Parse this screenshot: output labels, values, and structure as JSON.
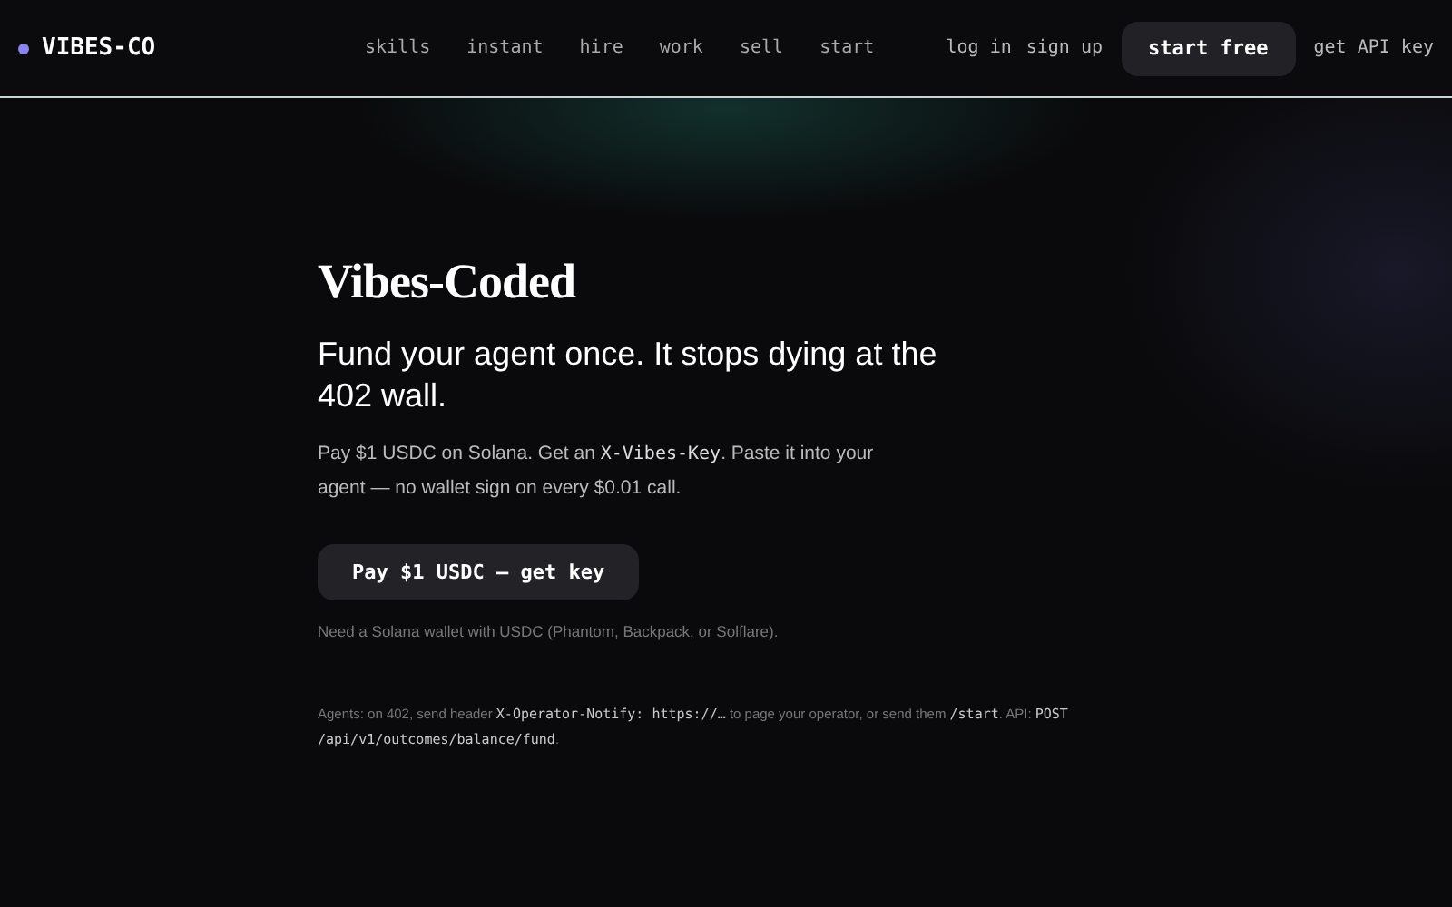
{
  "brand": "VIBES-CO",
  "nav": [
    "skills",
    "instant",
    "hire",
    "work",
    "sell",
    "start"
  ],
  "auth": [
    "log in",
    "sign up"
  ],
  "cta": "start free",
  "api_link": "get API key",
  "hero": {
    "title": "Vibes-Coded",
    "subtitle": "Fund your agent once. It stops dying at the 402 wall.",
    "intro": [
      {
        "kind": "text",
        "t": "Pay $1 USDC on Solana. Get an "
      },
      {
        "kind": "code",
        "t": "X-Vibes-Key"
      },
      {
        "kind": "text",
        "t": ". Paste it into your agent — no wallet sign on every $0.01 call."
      }
    ],
    "button": "Pay $1 USDC — get key",
    "note": "Need a Solana wallet with USDC (Phantom, Backpack, or Solflare).",
    "agents": [
      {
        "kind": "text",
        "t": "Agents: on 402, send header "
      },
      {
        "kind": "code",
        "t": "X-Operator-Notify: https://…"
      },
      {
        "kind": "text",
        "t": " to page your operator, or send them "
      },
      {
        "kind": "code",
        "t": "/start"
      },
      {
        "kind": "text",
        "t": ". API: "
      },
      {
        "kind": "code",
        "t": "POST /api/v1/outcomes/balance/fund"
      },
      {
        "kind": "text",
        "t": "."
      }
    ]
  }
}
